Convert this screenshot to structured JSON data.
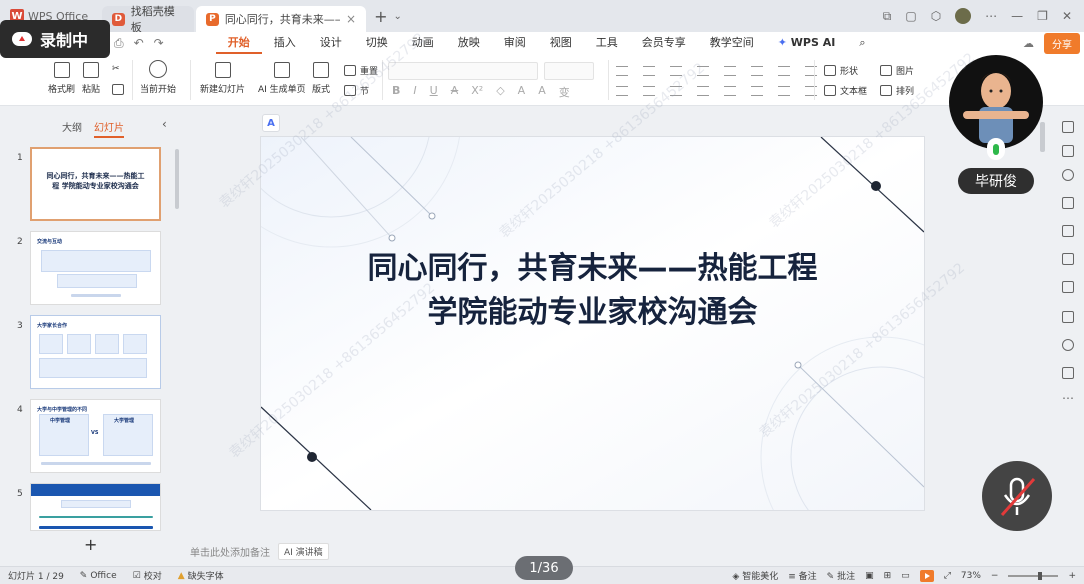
{
  "recording": {
    "label": "录制中"
  },
  "titlebar": {
    "app_name": "WPS Office",
    "tabs": [
      {
        "label": "找稻壳模板",
        "icon": "D"
      },
      {
        "label": "同心同行，共育未来——热能工程",
        "icon": "P"
      }
    ]
  },
  "menu": {
    "items": [
      "开始",
      "插入",
      "设计",
      "切换",
      "动画",
      "放映",
      "审阅",
      "视图",
      "工具",
      "会员专享",
      "教学空间"
    ],
    "ai_label": "WPS AI",
    "share": "分享"
  },
  "toolbar": {
    "format_painter": "格式刷",
    "paste": "粘贴",
    "start_from_current": "当前开始",
    "new_slide": "新建幻灯片",
    "ai_single_page": "AI 生成单页",
    "layout": "版式",
    "reset": "重置",
    "section": "节",
    "shape": "形状",
    "picture": "图片",
    "textbox": "文本框",
    "arrange": "排列"
  },
  "left_panel": {
    "tab_outline": "大纲",
    "tab_slides": "幻灯片",
    "thumbs": [
      {
        "num": "1",
        "title": "同心同行，共育未来——热能工程 学院能动专业家校沟通会"
      },
      {
        "num": "2",
        "header": "交流与互动"
      },
      {
        "num": "3",
        "header": "大学家长合作"
      },
      {
        "num": "4",
        "header": "大学与中学管理的不同",
        "col_a": "中学管理",
        "col_b": "大学管理",
        "vs": "VS"
      },
      {
        "num": "5",
        "header": ""
      }
    ]
  },
  "slide": {
    "title_line1": "同心同行，共育未来——热能工程",
    "title_line2": "学院能动专业家校沟通会"
  },
  "notes": {
    "placeholder": "单击此处添加备注",
    "ai_notes": "AI 演讲稿"
  },
  "page_indicator": "1/36",
  "presenter": {
    "name": "毕研俊"
  },
  "statusbar": {
    "slide_count": "幻灯片 1 / 29",
    "office": "Office",
    "proofread": "校对",
    "missing_font": "缺失字体",
    "smart_beautify": "智能美化",
    "notes": "备注",
    "comments": "批注",
    "zoom": "73%"
  },
  "watermark": {
    "text": "袁纹轩202503021​8 +8613656452792"
  }
}
